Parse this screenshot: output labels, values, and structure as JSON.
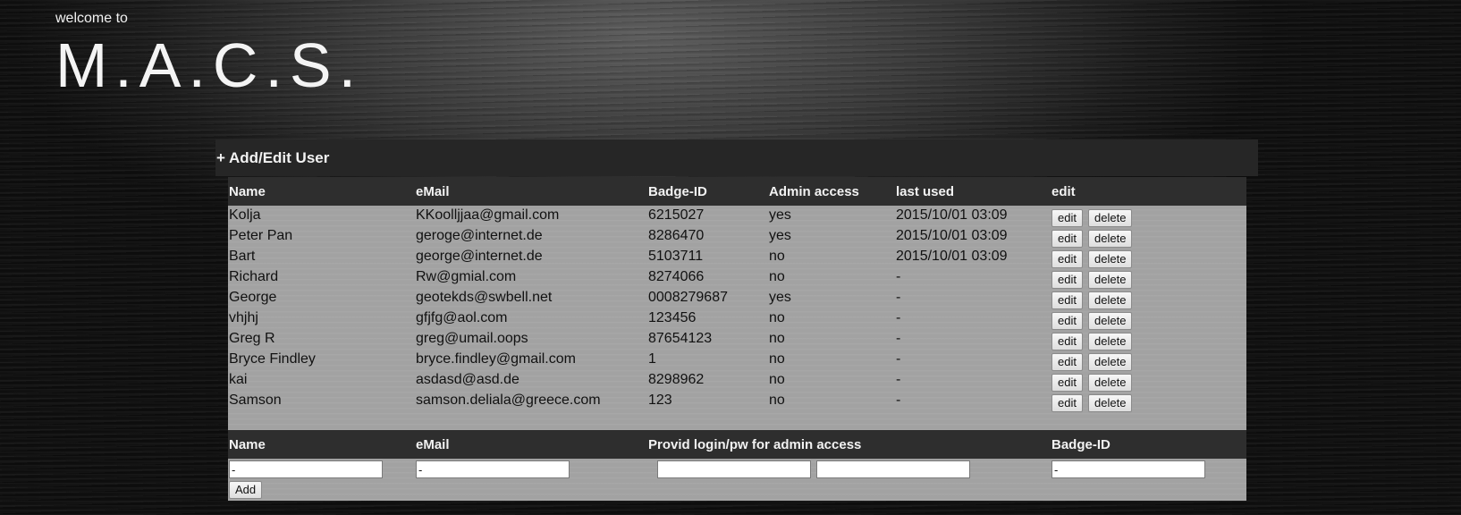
{
  "header": {
    "welcome": "welcome to",
    "logo": "M.A.C.S."
  },
  "panel": {
    "plus": "+",
    "title": "Add/Edit User"
  },
  "users_table": {
    "columns": [
      "Name",
      "eMail",
      "Badge-ID",
      "Admin access",
      "last used",
      "edit"
    ],
    "rows": [
      {
        "name": "Kolja",
        "email": "KKoolljjaa@gmail.com",
        "badge": "6215027",
        "admin": "yes",
        "last_used": "2015/10/01 03:09"
      },
      {
        "name": "Peter Pan",
        "email": "geroge@internet.de",
        "badge": "8286470",
        "admin": "yes",
        "last_used": "2015/10/01 03:09"
      },
      {
        "name": "Bart",
        "email": "george@internet.de",
        "badge": "5103711",
        "admin": "no",
        "last_used": "2015/10/01 03:09"
      },
      {
        "name": "Richard",
        "email": "Rw@gmial.com",
        "badge": "8274066",
        "admin": "no",
        "last_used": "-"
      },
      {
        "name": "George",
        "email": "geotekds@swbell.net",
        "badge": "0008279687",
        "admin": "yes",
        "last_used": "-"
      },
      {
        "name": "vhjhj",
        "email": "gfjfg@aol.com",
        "badge": "123456",
        "admin": "no",
        "last_used": "-"
      },
      {
        "name": "Greg R",
        "email": "greg@umail.oops",
        "badge": "87654123",
        "admin": "no",
        "last_used": "-"
      },
      {
        "name": "Bryce Findley",
        "email": "bryce.findley@gmail.com",
        "badge": "1",
        "admin": "no",
        "last_used": "-"
      },
      {
        "name": "kai",
        "email": "asdasd@asd.de",
        "badge": "8298962",
        "admin": "no",
        "last_used": "-"
      },
      {
        "name": "Samson",
        "email": "samson.deliala@greece.com",
        "badge": "123",
        "admin": "no",
        "last_used": "-"
      }
    ],
    "edit_label": "edit",
    "delete_label": "delete"
  },
  "add_form": {
    "columns": [
      "Name",
      "eMail",
      "Provid login/pw for admin access",
      "Badge-ID"
    ],
    "name_value": "-",
    "email_value": "-",
    "login_value": "",
    "password_value": "",
    "badge_value": "-",
    "add_label": "Add"
  }
}
